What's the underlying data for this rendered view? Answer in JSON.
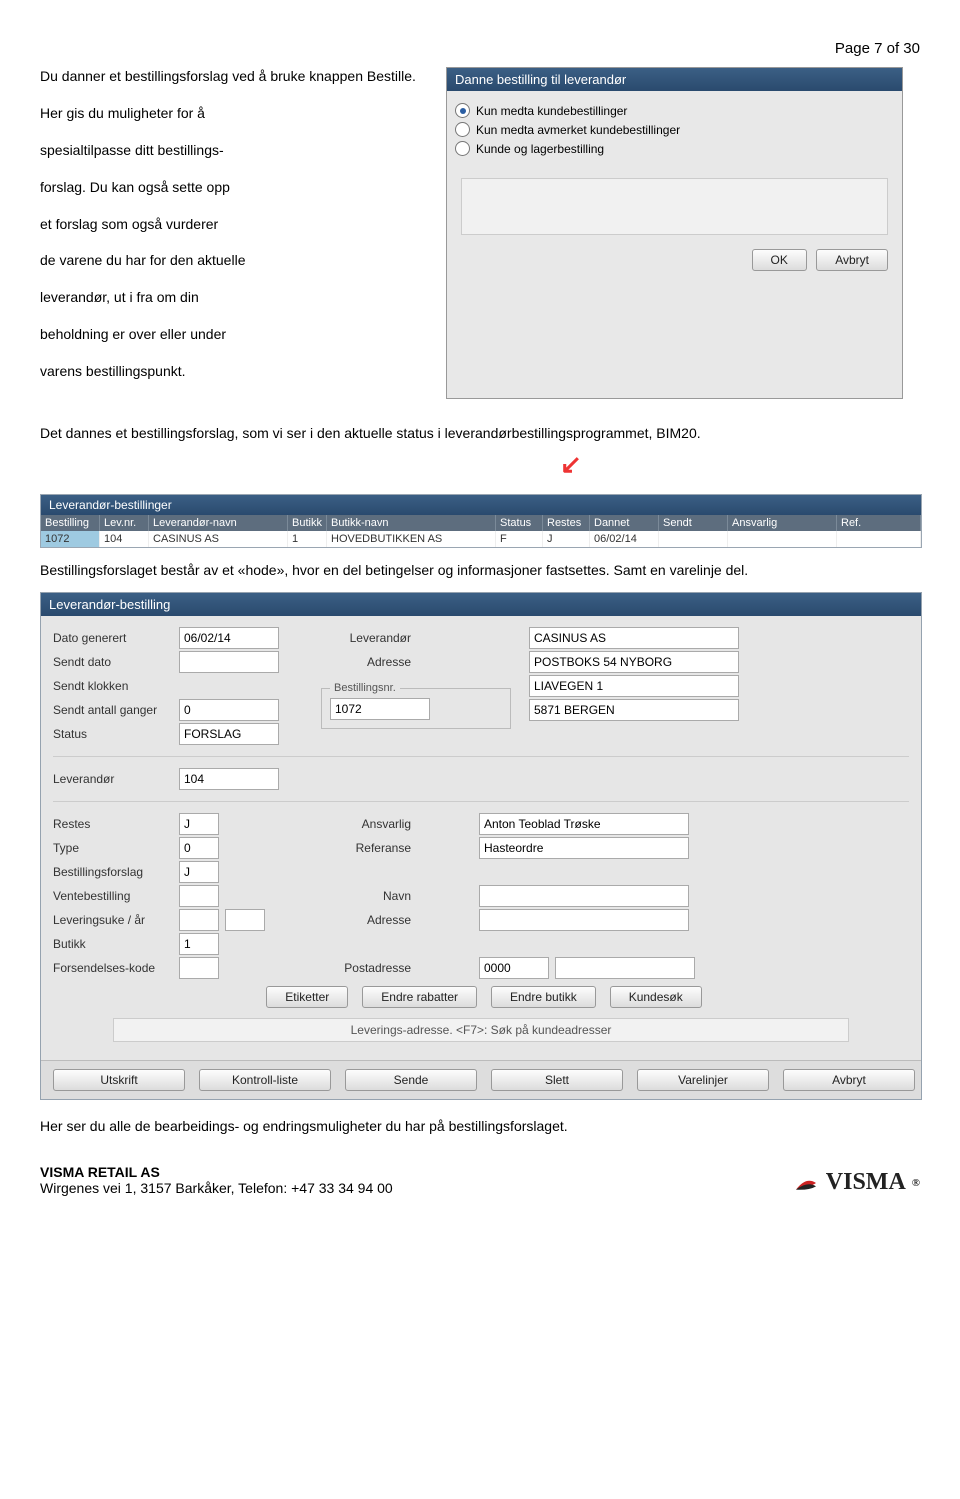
{
  "page": {
    "counter": "Page 7 of 30"
  },
  "intro": {
    "p1": "Du danner et bestillingsforslag ved å bruke knappen Bestille.",
    "p2": "Her gis du muligheter for å",
    "p3": "spesialtilpasse ditt bestillings-",
    "p4": "forslag. Du kan også sette opp",
    "p5": "et forslag som også vurderer",
    "p6": "de varene du har for den aktuelle",
    "p7": "leverandør, ut i fra om din",
    "p8": "beholdning er over eller under",
    "p9": "varens bestillingspunkt."
  },
  "dialog1": {
    "title": "Danne bestilling til leverandør",
    "opt1": "Kun medta kundebestillinger",
    "opt2": "Kun medta avmerket kundebestillinger",
    "opt3": "Kunde og lagerbestilling",
    "ok": "OK",
    "cancel": "Avbryt"
  },
  "para2": "Det dannes et bestillingsforslag, som vi ser i den aktuelle status i leverandørbestillingsprogrammet, BIM20.",
  "list": {
    "title": "Leverandør-bestillinger",
    "headers": [
      "Bestilling",
      "Lev.nr.",
      "Leverandør-navn",
      "Butikk",
      "Butikk-navn",
      "Status",
      "Restes",
      "Dannet",
      "Sendt",
      "Ansvarlig",
      "Ref."
    ],
    "row": {
      "best": "1072",
      "lev": "104",
      "levnavn": "CASINUS AS",
      "butikk": "1",
      "butnavn": "HOVEDBUTIKKEN AS",
      "status": "F",
      "restes": "J",
      "dannet": "06/02/14",
      "sendt": "",
      "ansv": "",
      "ref": ""
    }
  },
  "para3": "Bestillingsforslaget består av et «hode», hvor en del betingelser og informasjoner fastsettes. Samt en varelinje del.",
  "form": {
    "title": "Leverandør-bestilling",
    "labels": {
      "datogen": "Dato generert",
      "sendtdato": "Sendt dato",
      "sendtkl": "Sendt klokken",
      "sendtant": "Sendt antall ganger",
      "status": "Status",
      "leverandor": "Leverandør",
      "adresse": "Adresse",
      "bestnr": "Bestillingsnr.",
      "lev2": "Leverandør",
      "restes": "Restes",
      "type": "Type",
      "bestfor": "Bestillingsforslag",
      "ventebest": "Ventebestilling",
      "levuke": "Leveringsuke / år",
      "butikk": "Butikk",
      "forsend": "Forsendelses-kode",
      "ansvarlig": "Ansvarlig",
      "referanse": "Referanse",
      "navn": "Navn",
      "adresse2": "Adresse",
      "postadr": "Postadresse"
    },
    "values": {
      "datogen": "06/02/14",
      "sendtant": "0",
      "status": "FORSLAG",
      "bestnr": "1072",
      "levnavn": "CASINUS AS",
      "adr1": "POSTBOKS 54 NYBORG",
      "adr2": "LIAVEGEN 1",
      "adr3": "5871 BERGEN",
      "lev2": "104",
      "restes": "J",
      "type": "0",
      "bestfor": "J",
      "butikk": "1",
      "ansvarlig": "Anton Teoblad Trøske",
      "referanse": "Hasteordre",
      "post": "0000"
    },
    "btns1": {
      "etik": "Etiketter",
      "rabb": "Endre rabatter",
      "butikk": "Endre butikk",
      "kunde": "Kundesøk"
    },
    "delivery": "Leverings-adresse. <F7>: Søk på kundeadresser",
    "btns2": {
      "utskrift": "Utskrift",
      "kontroll": "Kontroll-liste",
      "sende": "Sende",
      "slett": "Slett",
      "varelinjer": "Varelinjer",
      "avbryt": "Avbryt"
    }
  },
  "para4": "Her ser du alle de bearbeidings- og endringsmuligheter du har på bestillingsforslaget.",
  "footer": {
    "company": "VISMA RETAIL AS",
    "addr": "Wirgenes vei 1, 3157 Barkåker, Telefon: +47 33 34 94 00",
    "logo": "VISMA"
  }
}
